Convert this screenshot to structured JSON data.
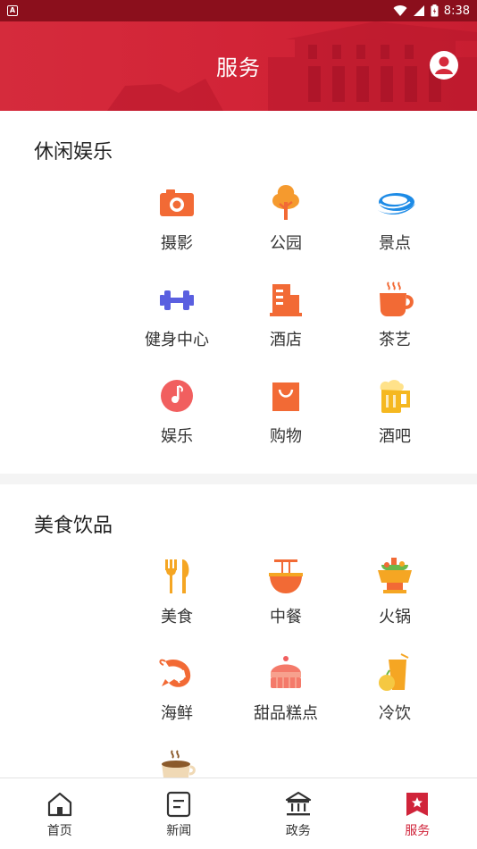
{
  "status_bar": {
    "time": "8:38",
    "notification_glyph": "A",
    "icons": [
      "wifi-icon",
      "signal-icon",
      "battery-icon"
    ]
  },
  "header": {
    "title": "服务",
    "icons": [
      "profile-icon"
    ]
  },
  "colors": {
    "primary": "#d52b3c",
    "status_bar": "#8b0f1c",
    "active_nav": "#d0243a",
    "icon_orange": "#f26a35",
    "icon_yellow": "#f5b820"
  },
  "sections": [
    {
      "title": "休闲娱乐",
      "items": [
        {
          "label": "摄影",
          "icon": "camera-icon"
        },
        {
          "label": "公园",
          "icon": "tree-icon"
        },
        {
          "label": "景点",
          "icon": "wave-icon"
        },
        {
          "label": "健身中心",
          "icon": "dumbbell-icon"
        },
        {
          "label": "酒店",
          "icon": "building-icon"
        },
        {
          "label": "茶艺",
          "icon": "tea-cup-icon"
        },
        {
          "label": "娱乐",
          "icon": "music-note-icon"
        },
        {
          "label": "购物",
          "icon": "shopping-bag-icon"
        },
        {
          "label": "酒吧",
          "icon": "beer-mug-icon"
        }
      ]
    },
    {
      "title": "美食饮品",
      "items": [
        {
          "label": "美食",
          "icon": "fork-knife-icon"
        },
        {
          "label": "中餐",
          "icon": "noodle-bowl-icon"
        },
        {
          "label": "火锅",
          "icon": "hotpot-icon"
        },
        {
          "label": "海鲜",
          "icon": "shrimp-icon"
        },
        {
          "label": "甜品糕点",
          "icon": "cake-icon"
        },
        {
          "label": "冷饮",
          "icon": "juice-icon"
        },
        {
          "label": "",
          "icon": "coffee-cup-icon"
        }
      ]
    }
  ],
  "bottom_nav": [
    {
      "label": "首页",
      "icon": "home-icon",
      "active": false
    },
    {
      "label": "新闻",
      "icon": "news-icon",
      "active": false
    },
    {
      "label": "政务",
      "icon": "government-icon",
      "active": false
    },
    {
      "label": "服务",
      "icon": "service-icon",
      "active": true
    }
  ]
}
